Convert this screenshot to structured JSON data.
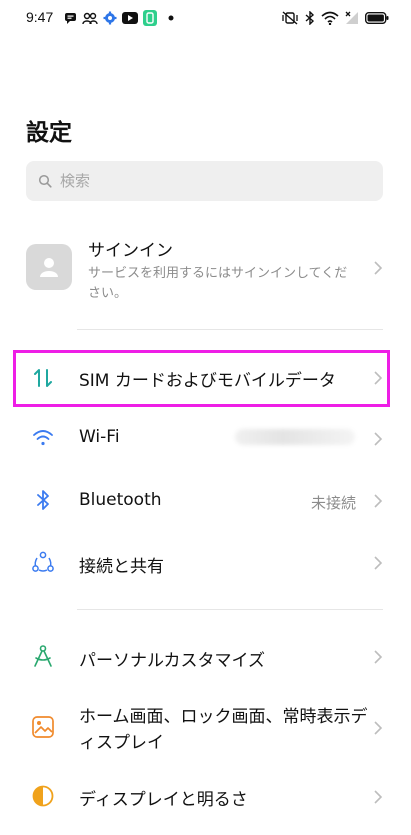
{
  "status_bar": {
    "time": "9:47",
    "left_icons": [
      "message-icon",
      "people-icon",
      "gear-icon",
      "youtube-icon",
      "app-icon",
      "dot-icon"
    ],
    "right_icons": [
      "mute-vibrate-icon",
      "bluetooth-icon",
      "wifi-icon",
      "no-signal-icon",
      "battery-icon"
    ]
  },
  "page": {
    "title": "設定"
  },
  "search": {
    "placeholder": "検索"
  },
  "account": {
    "title": "サインイン",
    "subtitle": "サービスを利用するにはサインインしてください。"
  },
  "menu": [
    {
      "label": "SIM カードおよびモバイルデータ",
      "icon": "sim-data-icon",
      "color": "#1fa8a0"
    },
    {
      "label": "Wi-Fi",
      "icon": "wifi-icon",
      "color": "#3b7bf0"
    },
    {
      "label": "Bluetooth",
      "value": "未接続",
      "icon": "bluetooth-icon",
      "color": "#3b7bf0"
    },
    {
      "label": "接続と共有",
      "icon": "share-nodes-icon",
      "color": "#3b7bf0"
    },
    {
      "label": "パーソナルカスタマイズ",
      "icon": "compass-icon",
      "color": "#2aa86f"
    },
    {
      "label": "ホーム画面、ロック画面、常時表示ディスプレイ",
      "icon": "wallpaper-icon",
      "color": "#f08a2c"
    },
    {
      "label": "ディスプレイと明るさ",
      "icon": "brightness-icon",
      "color": "#f0a21c"
    }
  ],
  "colors": {
    "highlight": "#ee1ee6",
    "accent_teal": "#1fa8a0",
    "accent_blue": "#3b7bf0"
  }
}
